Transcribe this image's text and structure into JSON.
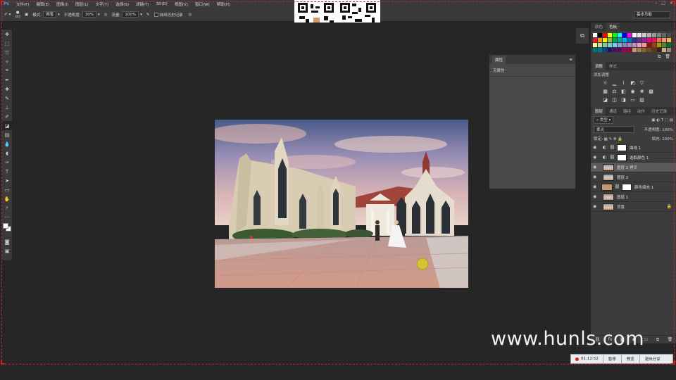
{
  "app": {
    "logo": "Ps"
  },
  "menu": [
    "文件(F)",
    "编辑(E)",
    "图像(I)",
    "图层(L)",
    "文字(Y)",
    "选择(S)",
    "滤镜(T)",
    "3D(D)",
    "视图(V)",
    "窗口(W)",
    "帮助(H)"
  ],
  "options": {
    "brush_size": "400",
    "mode_label": "模式:",
    "mode_value": "画笔",
    "opacity_label": "不透明度:",
    "opacity_value": "30%",
    "flow_label": "流量:",
    "flow_value": "100%",
    "erase_history_label": "抹到历史记录",
    "workspace": "基本功能"
  },
  "properties": {
    "tab": "属性",
    "content": "无属性"
  },
  "panels": {
    "color_tab": "颜色",
    "swatches_tab": "色板",
    "adjust_tab": "调整",
    "styles_tab": "样式",
    "adjust_title": "添加调整",
    "layers_tabs": [
      "图层",
      "通道",
      "路径",
      "动作",
      "历史记录"
    ],
    "kind_label": "类型",
    "blend_mode": "柔光",
    "opacity_label": "不透明度:",
    "opacity_value": "100%",
    "lock_label": "锁定:",
    "fill_label": "填充:",
    "fill_value": "100%"
  },
  "layers": [
    {
      "name": "曲线 1",
      "type": "adjust",
      "icon": "curves-icon",
      "selected": false
    },
    {
      "name": "选取颜色 1",
      "type": "adjust",
      "icon": "selective-color-icon",
      "selected": false
    },
    {
      "name": "图层 2 拷贝",
      "type": "photo",
      "selected": true
    },
    {
      "name": "图层 2",
      "type": "photo",
      "selected": false
    },
    {
      "name": "颜色填充 1",
      "type": "fill",
      "color": "#c49a72",
      "selected": false
    },
    {
      "name": "图层 1",
      "type": "photo",
      "selected": false
    },
    {
      "name": "背景",
      "type": "photo",
      "selected": false,
      "locked": true
    }
  ],
  "watermark": "www.hunls.com",
  "recording": {
    "time": "01:12:52",
    "pause": "暂停",
    "preview": "预览",
    "exit": "退出分享"
  },
  "colors": {
    "accent": "#3fa6ff",
    "rec_dot": "#e02020"
  }
}
